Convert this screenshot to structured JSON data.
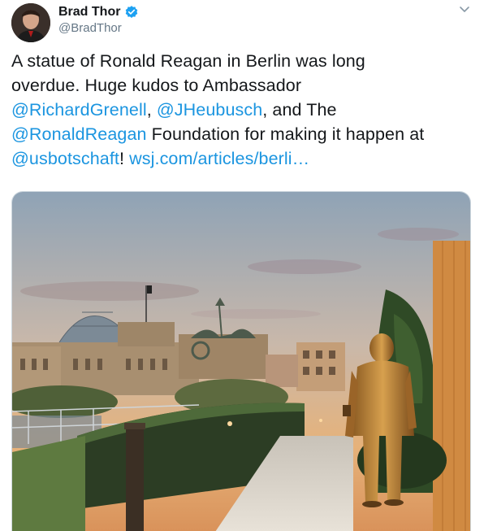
{
  "author": {
    "display_name": "Brad Thor",
    "handle": "@BradThor",
    "verified": true,
    "avatar_icon": "avatar-photo",
    "verified_icon": "verified-badge-icon",
    "menu_icon": "chevron-down-icon"
  },
  "tweet": {
    "line1": "A statue of Ronald Reagan in Berlin was long",
    "line2": "overdue.  Huge kudos to Ambassador",
    "mention1": "@RichardGrenell",
    "sep1": ", ",
    "mention2": "@JHeubusch",
    "sep2": ", and The",
    "mention3": "@RonaldReagan",
    "line4_rest": " Foundation for making it happen at",
    "mention4": "@usbotschaft",
    "sep3": "! ",
    "url": "wsj.com/articles/berli…"
  },
  "media": {
    "type": "photo",
    "scene": "photo-reagan-statue-berlin"
  },
  "colors": {
    "link": "#1b95e0",
    "text": "#14171a",
    "muted": "#657786",
    "verified": "#1da1f2"
  }
}
